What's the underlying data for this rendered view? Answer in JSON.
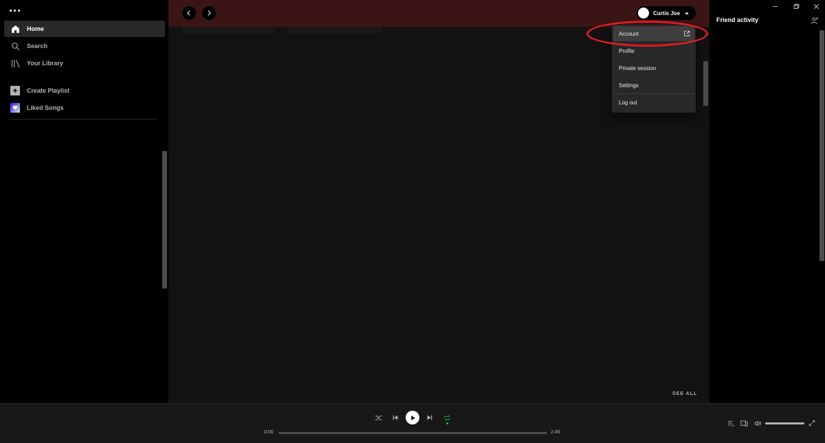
{
  "sidebar": {
    "items": [
      {
        "label": "Home",
        "icon": "home-icon",
        "active": true
      },
      {
        "label": "Search",
        "icon": "search-icon"
      },
      {
        "label": "Your Library",
        "icon": "library-icon"
      }
    ],
    "actions": [
      {
        "label": "Create Playlist",
        "icon": "plus-icon"
      },
      {
        "label": "Liked Songs",
        "icon": "heart-icon"
      }
    ]
  },
  "header": {
    "user_name": "Curtis Joe"
  },
  "dropdown": {
    "items": [
      {
        "label": "Account",
        "external": true
      },
      {
        "label": "Profile"
      },
      {
        "label": "Private session"
      },
      {
        "label": "Settings"
      },
      {
        "label": "Log out"
      }
    ]
  },
  "main": {
    "see_all": "SEE ALL"
  },
  "friend_activity": {
    "title": "Friend activity"
  },
  "player": {
    "current_time": "0:00",
    "total_time": "2:46"
  },
  "colors": {
    "accent": "#1db954",
    "highlight_circle": "#e31b23",
    "header_bg": "#3b1515"
  }
}
